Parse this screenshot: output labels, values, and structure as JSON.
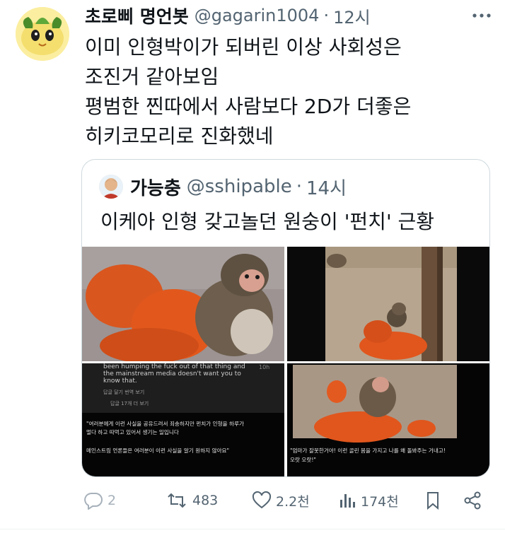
{
  "post": {
    "display_name": "초로삐 명언봇",
    "handle": "@gagarin1004",
    "separator": "·",
    "time": "12시",
    "text_lines": [
      "이미 인형박이가 되버린 이상 사회성은",
      "조진거 같아보임",
      "평범한 찐따에서 사람보다 2D가 더좋은",
      "히키코모리로 진화했네"
    ]
  },
  "quote": {
    "display_name": "가능충",
    "handle": "@sshipable",
    "separator": "·",
    "time": "14시",
    "text": "이케아 인형 갖고놀던 원숭이 '펀치' 근황",
    "images": {
      "comment_line1": "been humping the fuck out of that thing and",
      "comment_line2": "the mainstream media doesn't want you to",
      "comment_line3": "know that.",
      "comment_time": "10h",
      "comment_actions": "답글 달기     번역 보기",
      "comment_replies": "답글 17개 더 보기",
      "caption_kr1": "\"여러분에게 이런 사실을 공유드려서 죄송하지만 펀치가 인형을 하루가",
      "caption_kr2": "멀다 하고 따먹고 있어서 생기는 일입니다",
      "caption_kr3": "메인스트림 언론들은 여러분이 이런 사실을 알기 원하지 않아요\"",
      "caption_right1": "\"엄마가 잘못한거야! 이런 골린 몸을 가지고 나를 왜 돌봐주는 거내고!",
      "caption_right2": "오랏 오랏!\""
    }
  },
  "actions": {
    "reply_count": "2",
    "retweet_count": "483",
    "like_count": "2.2천",
    "view_count": "174천"
  },
  "colors": {
    "text": "#0f1419",
    "secondary": "#536471",
    "border": "#cfd9de",
    "doll": "#e8501f"
  }
}
